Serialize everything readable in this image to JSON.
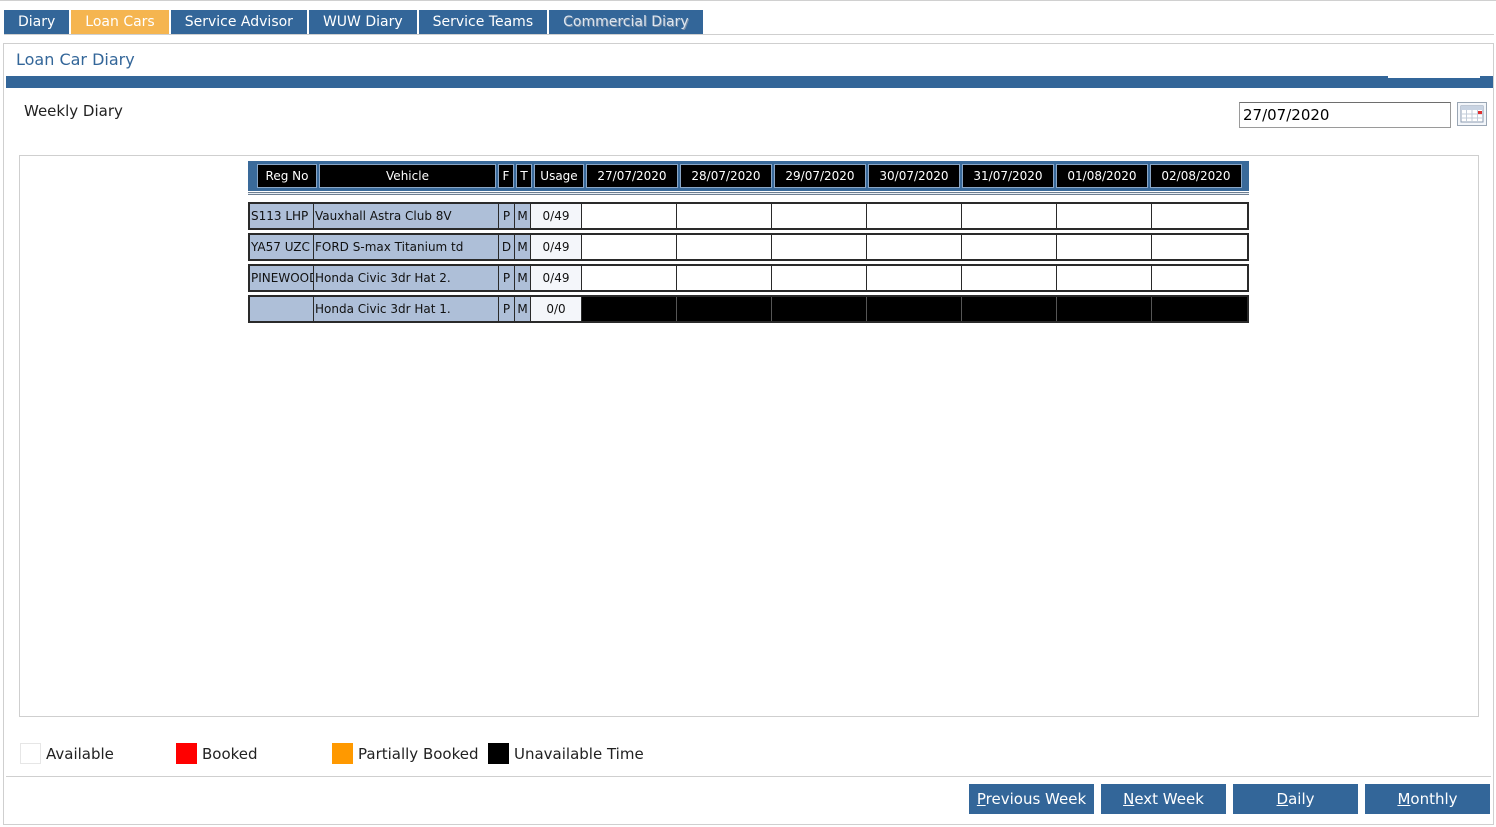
{
  "tabs": [
    {
      "label": "Diary",
      "active": false
    },
    {
      "label": "Loan Cars",
      "active": true
    },
    {
      "label": "Service Advisor",
      "active": false
    },
    {
      "label": "WUW Diary",
      "active": false
    },
    {
      "label": "Service Teams",
      "active": false
    },
    {
      "label": "Commercial Diary",
      "active": false
    }
  ],
  "page_title": "Loan Car Diary",
  "weekly_label": "Weekly Diary",
  "date_value": "27/07/2020",
  "calendar_icon": "calendar-icon",
  "grid": {
    "headers": {
      "reg": "Reg No",
      "vehicle": "Vehicle",
      "f": "F",
      "t": "T",
      "usage": "Usage",
      "days": [
        "27/07/2020",
        "28/07/2020",
        "29/07/2020",
        "30/07/2020",
        "31/07/2020",
        "01/08/2020",
        "02/08/2020"
      ]
    },
    "rows": [
      {
        "reg": "S113 LHP",
        "vehicle": "Vauxhall Astra Club 8V",
        "f": "P",
        "t": "M",
        "usage": "0/49",
        "day_status": [
          "available",
          "available",
          "available",
          "available",
          "available",
          "available",
          "available"
        ]
      },
      {
        "reg": "YA57 UZC",
        "vehicle": "FORD S-max Titanium td",
        "f": "D",
        "t": "M",
        "usage": "0/49",
        "day_status": [
          "available",
          "available",
          "available",
          "available",
          "available",
          "available",
          "available"
        ]
      },
      {
        "reg": "PINEWOOD",
        "vehicle": "Honda Civic 3dr Hat 2.",
        "f": "P",
        "t": "M",
        "usage": "0/49",
        "day_status": [
          "available",
          "available",
          "available",
          "available",
          "available",
          "available",
          "available"
        ]
      },
      {
        "reg": "",
        "vehicle": "Honda Civic 3dr Hat 1.",
        "f": "P",
        "t": "M",
        "usage": "0/0",
        "day_status": [
          "unavailable",
          "unavailable",
          "unavailable",
          "unavailable",
          "unavailable",
          "unavailable",
          "unavailable"
        ]
      }
    ]
  },
  "legend": [
    {
      "label": "Available",
      "color": "#ffffff"
    },
    {
      "label": "Booked",
      "color": "#ff0000"
    },
    {
      "label": "Partially Booked",
      "color": "#ff9900"
    },
    {
      "label": "Unavailable Time",
      "color": "#000000"
    }
  ],
  "buttons": {
    "previous_week": {
      "first": "P",
      "rest": "revious Week"
    },
    "next_week": {
      "first": "N",
      "rest": "ext Week"
    },
    "daily": {
      "first": "D",
      "rest": "aily"
    },
    "monthly": {
      "first": "M",
      "rest": "onthly"
    }
  },
  "colors": {
    "primary": "#336699",
    "active_tab": "#f5b550",
    "row_label_bg": "#aebfd8"
  }
}
